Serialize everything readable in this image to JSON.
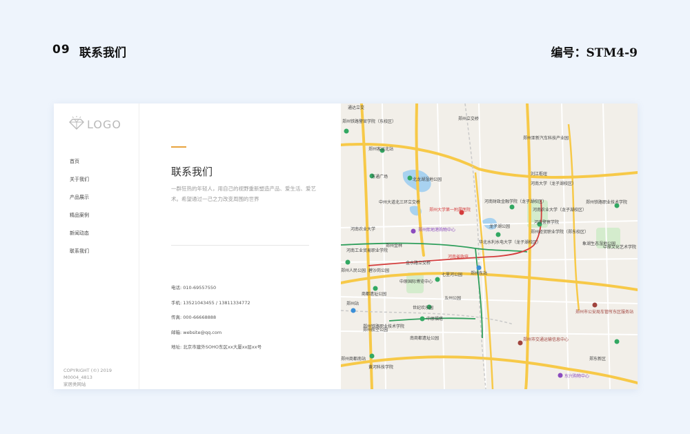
{
  "header": {
    "number": "09",
    "title": "联系我们",
    "code": "编号：STM4-9"
  },
  "sidebar": {
    "logo_text": "LOGO",
    "items": [
      {
        "label": "首页"
      },
      {
        "label": "关于我们"
      },
      {
        "label": "产品展示"
      },
      {
        "label": "精品案例"
      },
      {
        "label": "新闻动态"
      },
      {
        "label": "联系我们"
      }
    ],
    "copyright": [
      "COPYRIGHT (©) 2019 M0004_4813",
      "家居类网站"
    ]
  },
  "content": {
    "heading": "联系我们",
    "description": "一群狂热的年轻人，用自己的视野重新塑造产品、爱生活、爱艺术。希望通过一己之力改变周围的世界",
    "contact": [
      {
        "label": "电话:",
        "value": "010-69557550"
      },
      {
        "label": "手机:",
        "value": "13521043455 / 13811334772"
      },
      {
        "label": "传真:",
        "value": "000-66668888"
      },
      {
        "label": "邮箱:",
        "value": "website@qq.com"
      },
      {
        "label": "地址:",
        "value": "北京市建外SOHO东区xx大厦xx层xx号"
      }
    ]
  },
  "map": {
    "labels": [
      "通达立交",
      "郑州铁路警官学院（东校区）",
      "郑州立交桥",
      "郑州客运北站",
      "郑州亚新汽车科技产业园",
      "刘江枢纽",
      "北龙湖湿地公园",
      "河南大学（龙子湖校区）",
      "万通广场",
      "中州大道北三环立交桥",
      "郑州大学第一附属医院",
      "河南财政金融学院（龙子湖校区）",
      "河南农业大学（龙子湖校区）",
      "郑州铁路职业技术学院",
      "郑州熙地港购物中心",
      "河南警察学院",
      "河南农业大学",
      "龙子湖公园",
      "郑州经贸职业学院（郑东校区）",
      "华北水利水电大学（龙子湖校区）",
      "河南工业贸易职业学院",
      "郑州东站",
      "河南省政府",
      "郑州金林",
      "象湖生态湿地公园",
      "郑州人民公园",
      "碧沙岗公园",
      "金水路立交桥",
      "七里河公园",
      "中原国际博览中心",
      "商都遗址公园",
      "五州公园",
      "世纪欢乐园",
      "郑州站",
      "中原福塔",
      "郑州市公安局车管所东区服务站",
      "郑州航空公园",
      "郑州市交通运输信息中心",
      "南商都遗址公园",
      "东兴购物中心",
      "郑州铁路职业技术学院",
      "郑州商都南站",
      "黄河科技学院",
      "郑东新区",
      "中原文化艺术学院"
    ]
  },
  "colors": {
    "accent": "#e8a33d",
    "background": "#eef4fc",
    "road_major": "#f7c948",
    "metro_red": "#d43c3c",
    "metro_green": "#2e9e5b",
    "metro_purple": "#8b4bbf"
  }
}
